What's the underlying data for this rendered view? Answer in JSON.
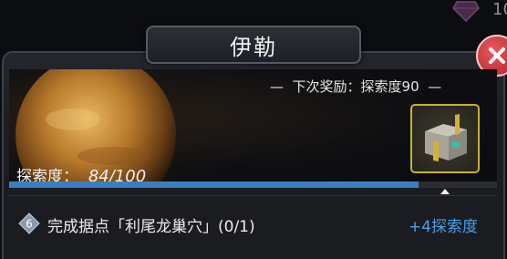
{
  "top_bar": {
    "gem_icon": "diamond-icon",
    "gem_count": "10"
  },
  "window": {
    "title": "伊勒",
    "close_icon": "close-icon"
  },
  "banner": {
    "next_reward_prefix": "—",
    "next_reward_label": "下次奖励：探索度90",
    "next_reward_suffix": "—",
    "explore_label": "探索度：",
    "explore_current": "84",
    "explore_total": "/100",
    "progress": 0.84,
    "chest_icon": "reward-chest-icon"
  },
  "task": {
    "badge_number": "6",
    "text": "完成据点「利尾龙巢穴」(0/1)",
    "reward": "+4探索度"
  },
  "colors": {
    "accent": "#3a7fc3",
    "reward_text": "#4a9fe6",
    "close": "#c83238"
  }
}
